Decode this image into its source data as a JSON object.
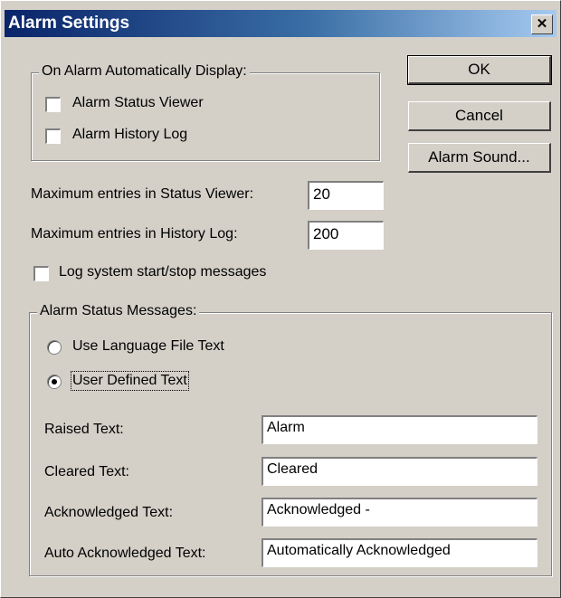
{
  "window": {
    "title": "Alarm Settings",
    "close_glyph": "✕"
  },
  "auto_display": {
    "legend": "On Alarm Automatically Display:",
    "status_viewer": {
      "label": "Alarm Status Viewer",
      "checked": false
    },
    "history_log": {
      "label": "Alarm History Log",
      "checked": false
    }
  },
  "buttons": {
    "ok": "OK",
    "cancel": "Cancel",
    "alarm_sound": "Alarm Sound..."
  },
  "limits": {
    "status_viewer_label": "Maximum entries in Status Viewer:",
    "status_viewer_value": "20",
    "history_log_label": "Maximum entries in History Log:",
    "history_log_value": "200"
  },
  "log_system": {
    "label": "Log system start/stop messages",
    "checked": false
  },
  "status_messages": {
    "legend": "Alarm Status Messages:",
    "use_language_file": {
      "label": "Use Language File Text",
      "selected": false
    },
    "user_defined": {
      "label": "User Defined Text",
      "selected": true
    },
    "raised_label": "Raised Text:",
    "raised_value": "Alarm",
    "cleared_label": "Cleared Text:",
    "cleared_value": "Cleared",
    "acknowledged_label": "Acknowledged Text:",
    "acknowledged_value": "Acknowledged -",
    "auto_ack_label": "Auto Acknowledged Text:",
    "auto_ack_value": "Automatically Acknowledged"
  }
}
